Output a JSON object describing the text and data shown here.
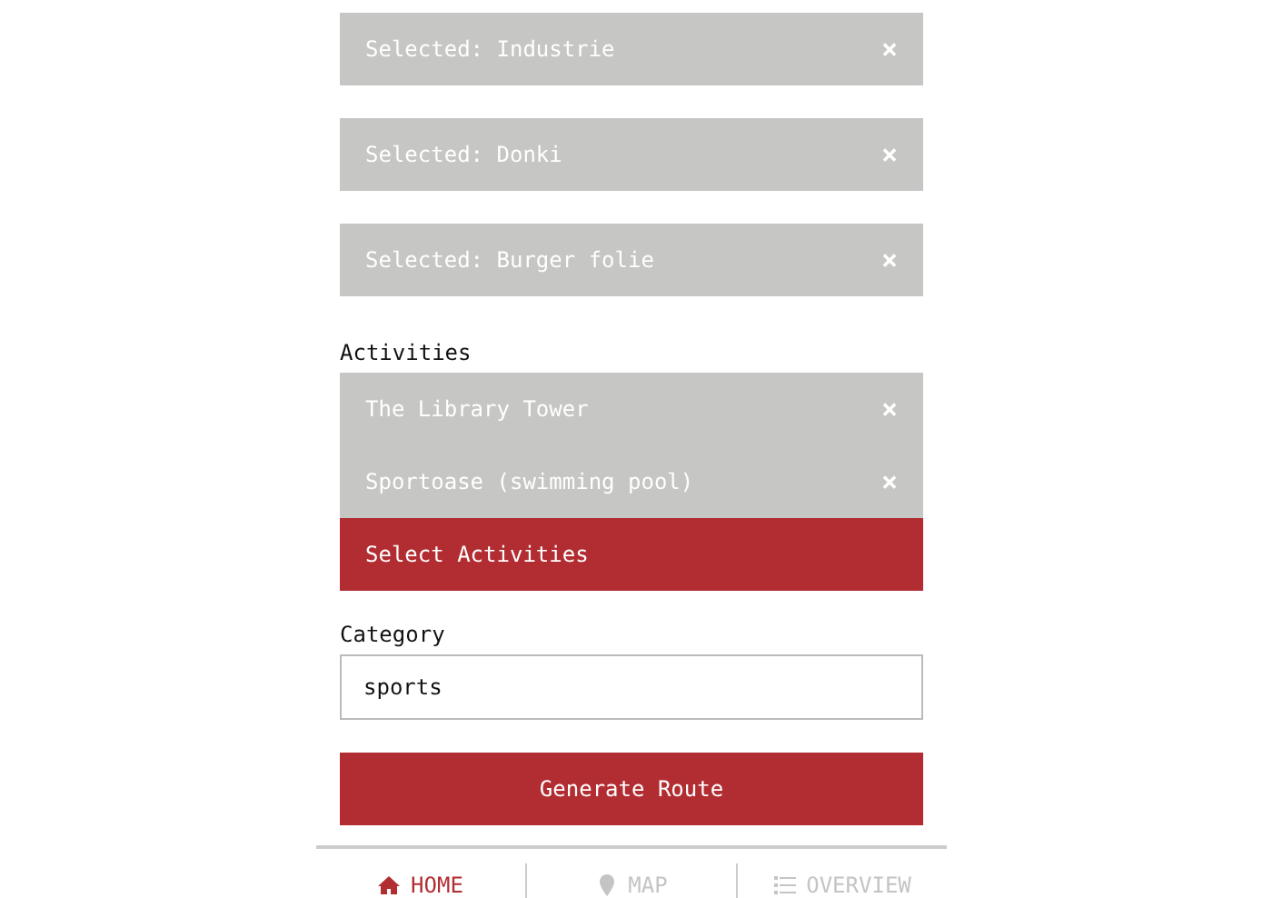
{
  "food_selections": [
    {
      "label": "Selected: Industrie",
      "remove": "×"
    },
    {
      "label": "Selected: Donki",
      "remove": "×"
    },
    {
      "label": "Selected: Burger folie",
      "remove": "×"
    }
  ],
  "activities": {
    "label": "Activities",
    "items": [
      {
        "label": "The Library Tower",
        "remove": "×"
      },
      {
        "label": "Sportoase (swimming pool)",
        "remove": "×"
      }
    ],
    "select_button": "Select Activities"
  },
  "category": {
    "label": "Category",
    "value": "sports"
  },
  "generate_button": "Generate Route",
  "nav": [
    {
      "label": "HOME",
      "selected": true
    },
    {
      "label": "MAP",
      "selected": false
    },
    {
      "label": "OVERVIEW",
      "selected": false
    }
  ]
}
